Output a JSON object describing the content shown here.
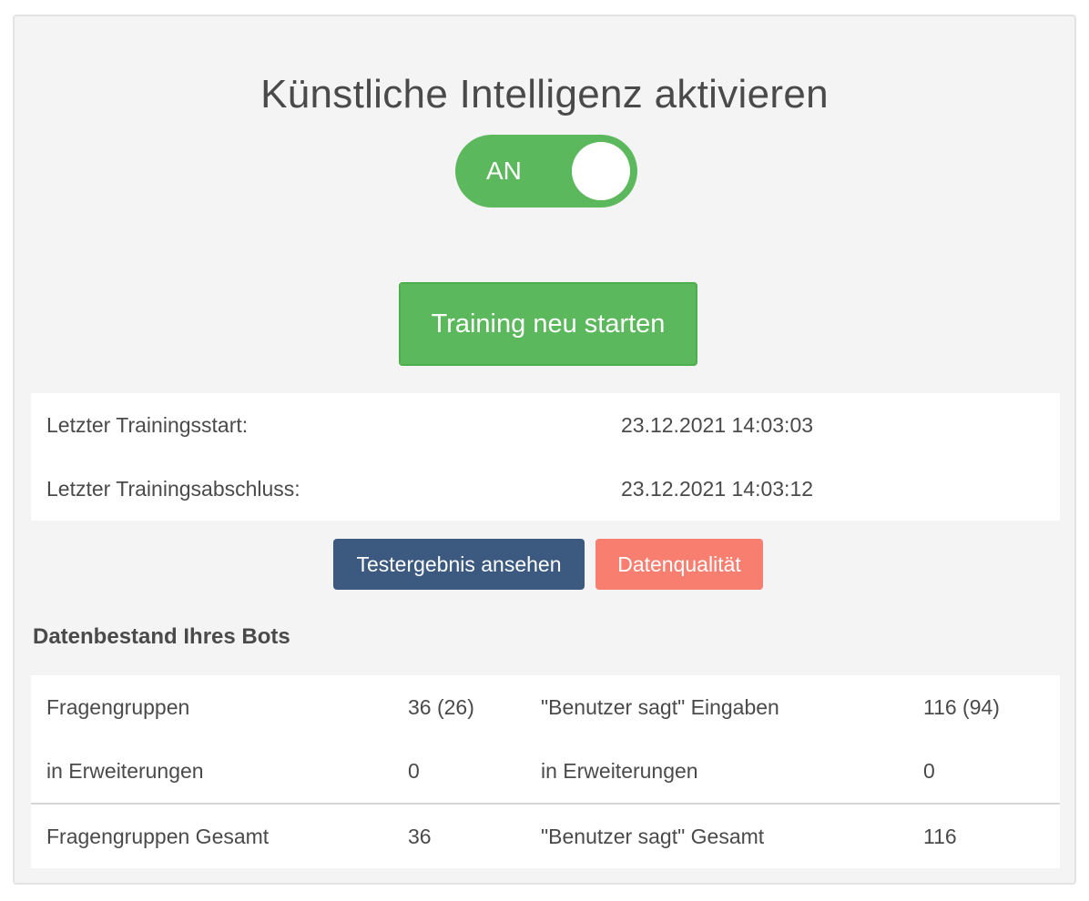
{
  "title": "Künstliche Intelligenz aktivieren",
  "toggle": {
    "label": "AN",
    "state": "on",
    "color": "#5cb85c"
  },
  "train_button": {
    "label": "Training neu starten",
    "color": "#5cb85c"
  },
  "training_info": {
    "rows": [
      {
        "label": "Letzter Trainingsstart:",
        "value": "23.12.2021 14:03:03"
      },
      {
        "label": "Letzter Trainingsabschluss:",
        "value": "23.12.2021 14:03:12"
      }
    ]
  },
  "actions": {
    "test_result_label": "Testergebnis ansehen",
    "test_result_color": "#3c5a80",
    "data_quality_label": "Datenqualität",
    "data_quality_color": "#f87f70"
  },
  "data_section": {
    "heading": "Datenbestand Ihres Bots",
    "rows": [
      {
        "label1": "Fragengruppen",
        "value1": "36 (26)",
        "label2": "\"Benutzer sagt\" Eingaben",
        "value2": "116 (94)"
      },
      {
        "label1": "in Erweiterungen",
        "value1": "0",
        "label2": "in Erweiterungen",
        "value2": "0"
      },
      {
        "label1": "Fragengruppen Gesamt",
        "value1": "36",
        "label2": "\"Benutzer sagt\" Gesamt",
        "value2": "116"
      }
    ]
  }
}
